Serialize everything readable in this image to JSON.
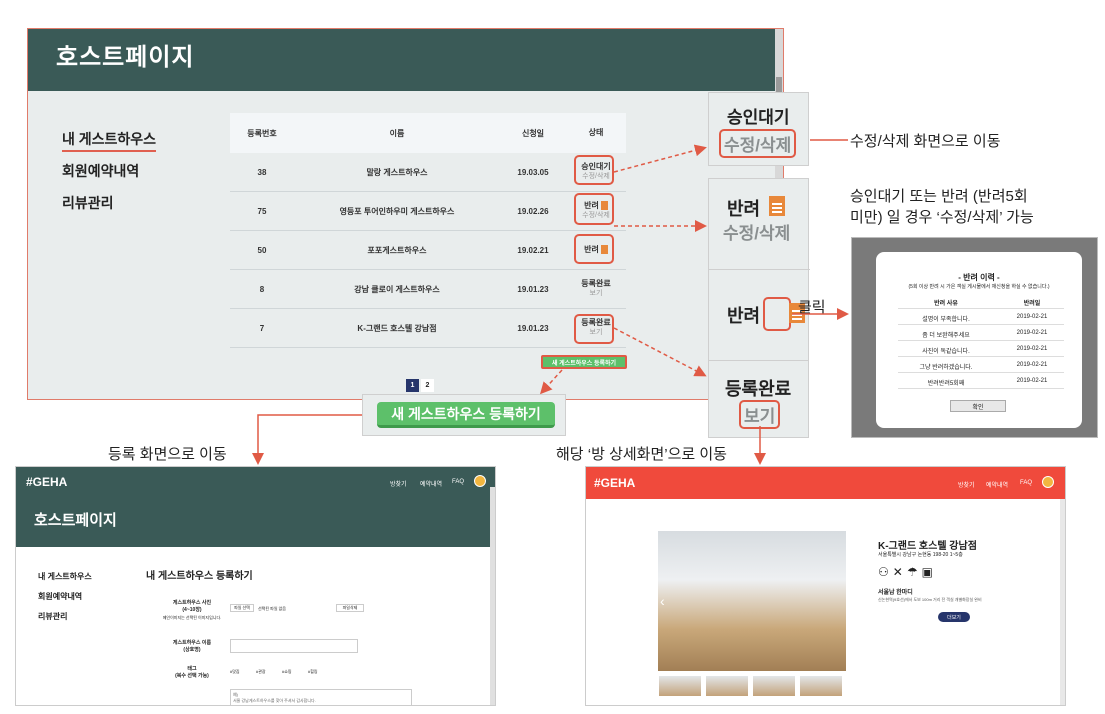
{
  "main": {
    "title": "호스트페이지",
    "sidebar": [
      "내 게스트하우스",
      "회원예약내역",
      "리뷰관리"
    ],
    "columns": [
      "등록번호",
      "이름",
      "신청일",
      "상태"
    ],
    "rows": [
      {
        "no": "38",
        "name": "말랑 게스트하우스",
        "date": "19.03.05",
        "status": "승인대기",
        "sub": "수정/삭제"
      },
      {
        "no": "75",
        "name": "영등포 투어인하우미 게스트하우스",
        "date": "19.02.26",
        "status": "반려",
        "sub": "수정/삭제"
      },
      {
        "no": "50",
        "name": "포포게스트하우스",
        "date": "19.02.21",
        "status": "반려",
        "sub": ""
      },
      {
        "no": "8",
        "name": "강남 클로이 게스트하우스",
        "date": "19.01.23",
        "status": "등록완료",
        "sub": "보기"
      },
      {
        "no": "7",
        "name": "K-그랜드 호스텔 강남점",
        "date": "19.01.23",
        "status": "등록완료",
        "sub": "보기"
      }
    ],
    "register_small": "새 게스트하우스 등록하기",
    "pages": [
      "1",
      "2"
    ]
  },
  "zoom": {
    "pending": "승인대기",
    "edit_delete": "수정/삭제",
    "rejected": "반려",
    "registered": "등록완료",
    "view": "보기",
    "register_big": "새 게스트하우스 등록하기"
  },
  "annotations": {
    "to_edit": "수정/삭제 화면으로 이동",
    "condition_line1": "승인대기 또는 반려 (반려5회",
    "condition_line2": "미만) 일 경우 ‘수정/삭제’ 가능",
    "click": "클릭",
    "to_register": "등록 화면으로 이동",
    "to_room": "해당 ‘방 상세화면’으로 이동"
  },
  "dialog": {
    "title": "- 반려 이력 -",
    "subtitle": "(5회 이상 반려 시 가은 객실 게시물에서 재신청을 하실 수 없습니다.)",
    "col_reason": "반려 사유",
    "col_date": "반려일",
    "rows": [
      {
        "reason": "설명이 부족합니다.",
        "date": "2019-02-21"
      },
      {
        "reason": "좀 더 보완해주세요",
        "date": "2019-02-21"
      },
      {
        "reason": "사진이 독같습니다.",
        "date": "2019-02-21"
      },
      {
        "reason": "그냥 반려하겠습니다.",
        "date": "2019-02-21"
      },
      {
        "reason": "반려반려5회째",
        "date": "2019-02-21"
      }
    ],
    "ok": "확인"
  },
  "register_page": {
    "logo": "#GEHA",
    "nav": [
      "방찾기",
      "예약내역",
      "FAQ"
    ],
    "title": "호스트페이지",
    "sidebar": [
      "내 게스트하우스",
      "회원예약내역",
      "리뷰관리"
    ],
    "heading": "내 게스트하우스 등록하기",
    "photo_label": "게스트하우스 사진\n(4~10장)",
    "photo_hint": "메인이미지는 선택된 이미지입니다.",
    "file_btn": "파일 선택",
    "file_text": "선택된 파일 없음",
    "delete_btn": "파일삭제",
    "name_label": "게스트하우스 이름\n(상호명)",
    "tag_label": "태그\n(복수 선택 가능)",
    "tags": [
      "#맛집",
      "#관광",
      "#쇼핑",
      "#힐링"
    ],
    "intro_placeholder": "예)\n서울 강남게스트하우스를 찾아 주셔서 감사합니다."
  },
  "room_page": {
    "logo": "#GEHA",
    "nav": [
      "방찾기",
      "예약내역",
      "FAQ"
    ],
    "name": "K-그랜드 호스텔 강남점",
    "address": "서울특별시 강남구 논현동 198-20 1~5층",
    "desc_title": "서울남 한마디",
    "desc": "신논현역(9호선)에서 도보 100m 거리 전 객실 개별화장실 완비",
    "more_btn": "더보기"
  },
  "colors": {
    "header": "#3a5a57",
    "red": "#e05a45",
    "green": "#5dc06a",
    "orange": "#e8883a",
    "coral": "#f04a3c"
  }
}
